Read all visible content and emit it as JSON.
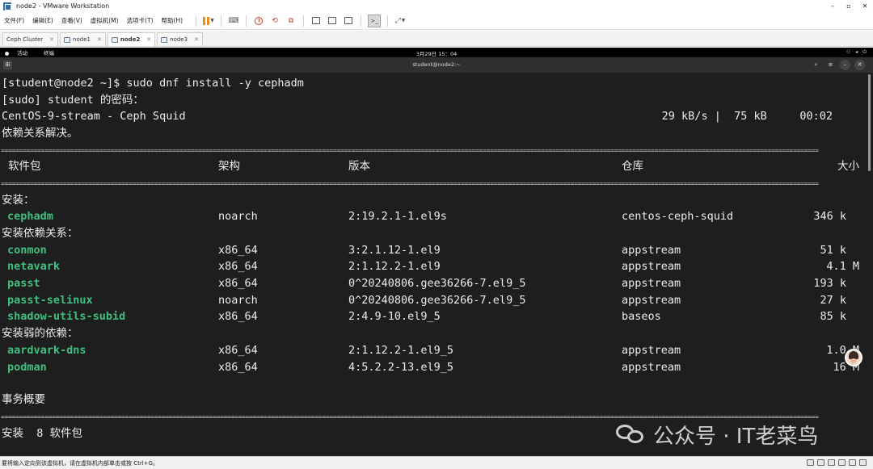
{
  "window": {
    "title": "node2 - VMware Workstation"
  },
  "menu": [
    "文件(F)",
    "编辑(E)",
    "查看(V)",
    "虚拟机(M)",
    "选项卡(T)",
    "帮助(H)"
  ],
  "tabs": [
    {
      "label": "Ceph Cluster",
      "active": false
    },
    {
      "label": "node1",
      "active": false
    },
    {
      "label": "node2",
      "active": true
    },
    {
      "label": "node3",
      "active": false
    }
  ],
  "gnome": {
    "activities": "活动",
    "app": "终端",
    "clock": "3月29日 15：04"
  },
  "terminal_window": {
    "title": "student@node2:~"
  },
  "terminal": {
    "command_line": "[student@node2 ~]$ sudo dnf install -y cephadm",
    "sudo_prompt": "[sudo] student 的密码：",
    "repo_name": "CentOS-9-stream - Ceph Squid",
    "repo_stats": "29 kB/s |  75 kB     00:02",
    "deps_resolved": "依赖关系解决。",
    "separator": "================================================================================================================================================================================================================================",
    "headers": {
      "package": "软件包",
      "arch": "架构",
      "version": "版本",
      "repo": "仓库",
      "size": "大小"
    },
    "sections": [
      {
        "title": "安装：",
        "rows": [
          {
            "name": "cephadm",
            "arch": "noarch",
            "version": "2:19.2.1-1.el9s",
            "repo": "centos-ceph-squid",
            "size": "346 k"
          }
        ]
      },
      {
        "title": "安装依赖关系：",
        "rows": [
          {
            "name": "conmon",
            "arch": "x86_64",
            "version": "3:2.1.12-1.el9",
            "repo": "appstream",
            "size": "51 k"
          },
          {
            "name": "netavark",
            "arch": "x86_64",
            "version": "2:1.12.2-1.el9",
            "repo": "appstream",
            "size": "4.1 M"
          },
          {
            "name": "passt",
            "arch": "x86_64",
            "version": "0^20240806.gee36266-7.el9_5",
            "repo": "appstream",
            "size": "193 k"
          },
          {
            "name": "passt-selinux",
            "arch": "noarch",
            "version": "0^20240806.gee36266-7.el9_5",
            "repo": "appstream",
            "size": "27 k"
          },
          {
            "name": "shadow-utils-subid",
            "arch": "x86_64",
            "version": "2:4.9-10.el9_5",
            "repo": "baseos",
            "size": "85 k"
          }
        ]
      },
      {
        "title": "安装弱的依赖：",
        "rows": [
          {
            "name": "aardvark-dns",
            "arch": "x86_64",
            "version": "2:1.12.2-1.el9_5",
            "repo": "appstream",
            "size": "1.0 M"
          },
          {
            "name": "podman",
            "arch": "x86_64",
            "version": "4:5.2.2-13.el9_5",
            "repo": "appstream",
            "size": "16 M"
          }
        ]
      }
    ],
    "summary_title": "事务概要",
    "summary_install": "安装  8 软件包"
  },
  "watermark": {
    "text": "公众号 · IT老菜鸟"
  },
  "statusbar": {
    "hint": "要将输入定向到该虚拟机，请在虚拟机内部单击或按 Ctrl+G。"
  },
  "colors": {
    "package_name": "#3fbf7f",
    "terminal_bg": "#1e1e1e",
    "pause_orange": "#f08a1c"
  },
  "icons": [
    "vmware-icon",
    "pause-icon",
    "send-keys-icon",
    "snapshot-icon",
    "revert-icon",
    "manage-snapshots-icon",
    "fullscreen-icon",
    "unity-icon",
    "console-view-icon",
    "stretch-icon",
    "new-tab-icon",
    "search-icon",
    "menu-icon",
    "minimize-icon",
    "close-icon"
  ]
}
